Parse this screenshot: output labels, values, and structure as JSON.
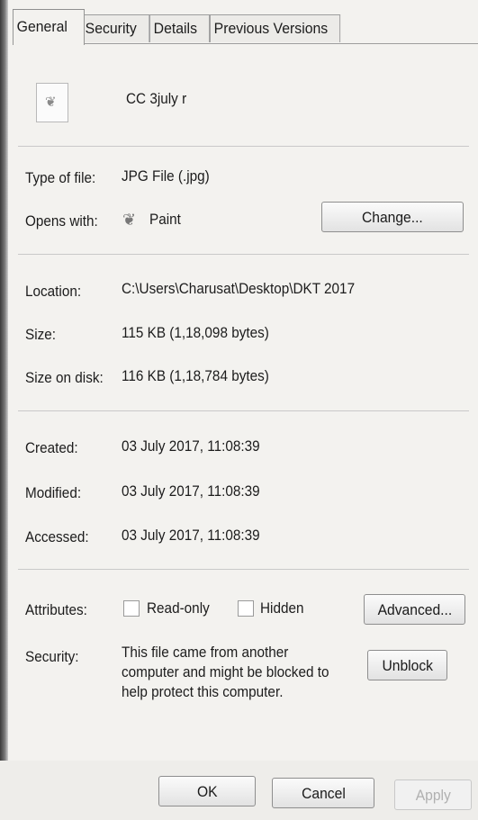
{
  "tabs": [
    {
      "label": "General",
      "active": true
    },
    {
      "label": "Security",
      "active": false
    },
    {
      "label": "Details",
      "active": false
    },
    {
      "label": "Previous Versions",
      "active": false
    }
  ],
  "file": {
    "name": "CC 3july r",
    "icon": "image-file-icon"
  },
  "type_section": {
    "type_label": "Type of file:",
    "type_value": "JPG File (.jpg)",
    "opens_label": "Opens with:",
    "opens_value": "Paint",
    "opens_icon": "paint-app-icon",
    "change_button": "Change..."
  },
  "location_section": {
    "location_label": "Location:",
    "location_value": "C:\\Users\\Charusat\\Desktop\\DKT 2017",
    "size_label": "Size:",
    "size_value": "115 KB (1,18,098 bytes)",
    "size_on_disk_label": "Size on disk:",
    "size_on_disk_value": "116 KB (1,18,784 bytes)"
  },
  "dates_section": {
    "created_label": "Created:",
    "created_value": "03 July 2017, 11:08:39",
    "modified_label": "Modified:",
    "modified_value": "03 July 2017, 11:08:39",
    "accessed_label": "Accessed:",
    "accessed_value": "03 July 2017, 11:08:39"
  },
  "attributes": {
    "label": "Attributes:",
    "readonly_label": "Read-only",
    "readonly_checked": false,
    "hidden_label": "Hidden",
    "hidden_checked": false,
    "advanced_button": "Advanced..."
  },
  "security": {
    "label": "Security:",
    "text": "This file came from another computer and might be blocked to help protect this computer.",
    "unblock_button": "Unblock"
  },
  "footer": {
    "ok": "OK",
    "cancel": "Cancel",
    "apply": "Apply"
  },
  "colors": {
    "background": "#f3f2ef",
    "separator": "#c9c9c9"
  }
}
